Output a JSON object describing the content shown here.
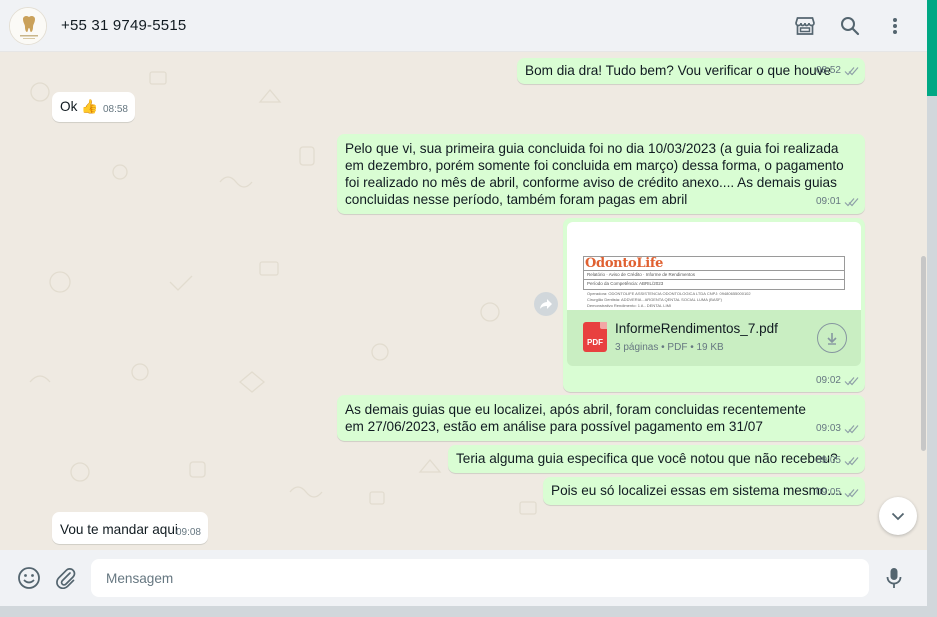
{
  "header": {
    "contact_name": "+55 31 9749-5515",
    "icons": [
      "avatar",
      "store-icon",
      "search-icon",
      "menu-dots-icon"
    ]
  },
  "messages": [
    {
      "direction": "out",
      "text": "Bom dia dra! Tudo bem? Vou verificar o que houve",
      "time": "08:52",
      "status": "read"
    },
    {
      "direction": "in",
      "text": "Ok 👍",
      "time": "08:58"
    },
    {
      "direction": "out",
      "text": "Pelo que vi, sua primeira guia concluida foi no dia 10/03/2023 (a guia foi realizada em dezembro, porém somente foi concluida em março) dessa forma, o pagamento foi realizado no mês de abril, conforme aviso de crédito anexo.... As demais guias concluidas nesse período, também foram pagas em abril",
      "time": "09:01",
      "status": "read"
    },
    {
      "direction": "out",
      "type": "document",
      "time": "09:02",
      "status": "read"
    },
    {
      "direction": "out",
      "text": "As demais guias que eu localizei, após abril, foram concluidas recentemente em 27/06/2023, estão em análise para possível pagamento em 31/07",
      "time": "09:03",
      "status": "read"
    },
    {
      "direction": "out",
      "text": "Teria alguma guia especifica que você notou que não recebeu?",
      "time": "09:05",
      "status": "read"
    },
    {
      "direction": "out",
      "text": "Pois eu só localizei essas em sistema mesmo....",
      "time": "09:05",
      "status": "read"
    },
    {
      "direction": "in",
      "text": "Vou te mandar aqui",
      "time": "09:08"
    }
  ],
  "document": {
    "file_name": "InformeRendimentos_7.pdf",
    "file_info": "3 páginas • PDF • 19 KB",
    "file_type_badge": "PDF",
    "preview": {
      "logo_text": "OdontoLife",
      "rows": [
        "Relatório · Aviso de Crédito · Informe de Rendimentos",
        "Período da Competência: ABRIL/2023"
      ],
      "fields": [
        "Operadora: ODONTOLIFE ASSISTENCIA ODONTOLOGICA LTDA  CNPJ: 09480655000102",
        "Cirurgião Dentista: ADDVERIA - ARGENTA QENTAL SOCIAL LUMA (BASF)",
        "Demonstrativo Rendimento: 1 A - DENTAL LIMI"
      ]
    }
  },
  "composer": {
    "placeholder": "Mensagem",
    "value": ""
  },
  "colors": {
    "incoming_bubble": "#ffffff",
    "outgoing_bubble": "#d9fdd3",
    "chat_background": "#efeae2",
    "read_tick": "#53bdeb",
    "accent": "#00a884"
  }
}
